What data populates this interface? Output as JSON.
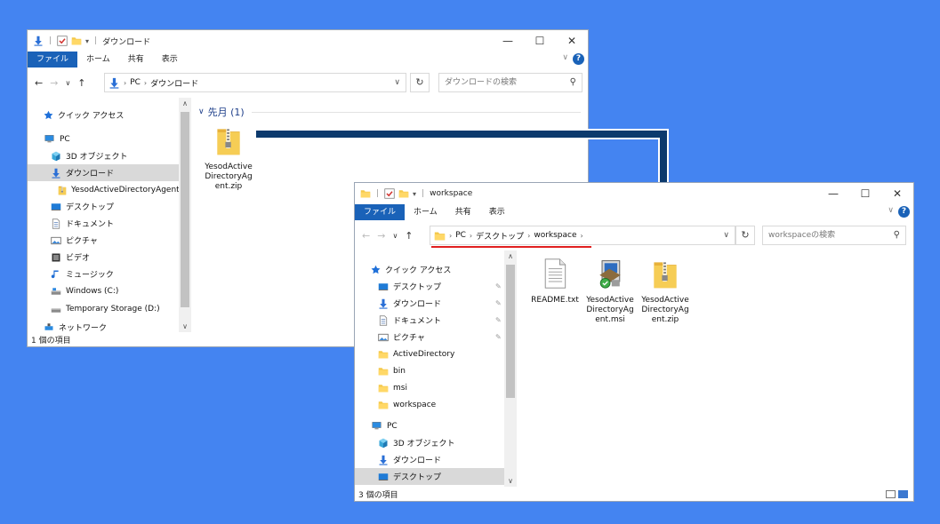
{
  "colors": {
    "background": "#4484f1",
    "accent": "#1a62b8",
    "arrow": "#0c3a6d",
    "highlight": "#e02020"
  },
  "window1": {
    "title": "ダウンロード",
    "ribbon": {
      "file": "ファイル",
      "home": "ホーム",
      "share": "共有",
      "view": "表示"
    },
    "breadcrumb": [
      "PC",
      "ダウンロード"
    ],
    "search_placeholder": "ダウンロードの検索",
    "group_header": "先月 (1)",
    "nav": [
      {
        "label": "クイック アクセス",
        "icon": "star-icon"
      },
      {
        "label": "PC",
        "icon": "pc-icon"
      },
      {
        "label": "3D オブジェクト",
        "icon": "cube-icon"
      },
      {
        "label": "ダウンロード",
        "icon": "download-icon"
      },
      {
        "label": "YesodActiveDirectoryAgent.zi",
        "icon": "zip-icon"
      },
      {
        "label": "デスクトップ",
        "icon": "desktop-icon"
      },
      {
        "label": "ドキュメント",
        "icon": "document-icon"
      },
      {
        "label": "ピクチャ",
        "icon": "picture-icon"
      },
      {
        "label": "ビデオ",
        "icon": "video-icon"
      },
      {
        "label": "ミュージック",
        "icon": "music-icon"
      },
      {
        "label": "Windows (C:)",
        "icon": "drive-icon"
      },
      {
        "label": "Temporary Storage (D:)",
        "icon": "drive-icon"
      },
      {
        "label": "ネットワーク",
        "icon": "network-icon"
      }
    ],
    "files": [
      {
        "name": "YesodActiveDirectoryAgent.zip",
        "icon": "zip-icon"
      }
    ],
    "status": "1 個の項目"
  },
  "window2": {
    "title": "workspace",
    "ribbon": {
      "file": "ファイル",
      "home": "ホーム",
      "share": "共有",
      "view": "表示"
    },
    "breadcrumb": [
      "PC",
      "デスクトップ",
      "workspace"
    ],
    "search_placeholder": "workspaceの検索",
    "nav": [
      {
        "label": "クイック アクセス",
        "icon": "star-icon"
      },
      {
        "label": "デスクトップ",
        "icon": "desktop-icon"
      },
      {
        "label": "ダウンロード",
        "icon": "download-icon"
      },
      {
        "label": "ドキュメント",
        "icon": "document-icon"
      },
      {
        "label": "ピクチャ",
        "icon": "picture-icon"
      },
      {
        "label": "ActiveDirectory",
        "icon": "folder-icon"
      },
      {
        "label": "bin",
        "icon": "folder-icon"
      },
      {
        "label": "msi",
        "icon": "folder-icon"
      },
      {
        "label": "workspace",
        "icon": "folder-icon"
      },
      {
        "label": "PC",
        "icon": "pc-icon"
      },
      {
        "label": "3D オブジェクト",
        "icon": "cube-icon"
      },
      {
        "label": "ダウンロード",
        "icon": "download-icon"
      },
      {
        "label": "デスクトップ",
        "icon": "desktop-icon"
      }
    ],
    "files": [
      {
        "name": "README.txt",
        "icon": "text-file-icon"
      },
      {
        "name": "YesodActiveDirectoryAgent.msi",
        "icon": "msi-installer-icon"
      },
      {
        "name": "YesodActiveDirectoryAgent.zip",
        "icon": "zip-icon"
      }
    ],
    "status": "3 個の項目"
  }
}
